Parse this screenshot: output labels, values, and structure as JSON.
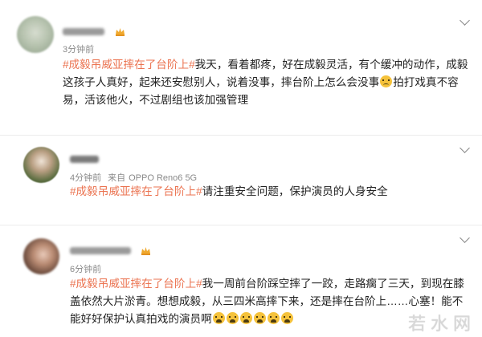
{
  "comments": [
    {
      "time": "3分钟前",
      "source": "",
      "device": "",
      "hashtag": "#成毅吊威亚摔在了台阶上#",
      "text_1": "我天，看着都疼，好在成毅灵活，有个缓冲的动作，成毅这孩子人真好，起来还安慰别人，说着没事，摔台阶上怎么会没事",
      "text_2": "拍打戏真不容易，活该他火，不过剧组也该加强管理"
    },
    {
      "time": "4分钟前",
      "source": "来自",
      "device": "OPPO Reno6 5G",
      "hashtag": "#成毅吊威亚摔在了台阶上#",
      "text_1": "请注重安全问题，保护演员的人身安全",
      "text_2": ""
    },
    {
      "time": "6分钟前",
      "source": "",
      "device": "",
      "hashtag": "#成毅吊威亚摔在了台阶上#",
      "text_1": "我一周前台阶踩空摔了一跤，走路瘸了三天，到现在膝盖依然大片淤青。想想成毅，从三四米高摔下来，还是摔在台阶上……心塞！能不能好好保护认真拍戏的演员啊",
      "text_2": ""
    }
  ],
  "watermark": "若水网",
  "colors": {
    "hashtag": "#eb7350",
    "meta": "#8a8a8a",
    "text": "#222222"
  },
  "icons": [
    "avatar",
    "chevron-down-icon",
    "member-badge-icon",
    "emoji-icon"
  ]
}
